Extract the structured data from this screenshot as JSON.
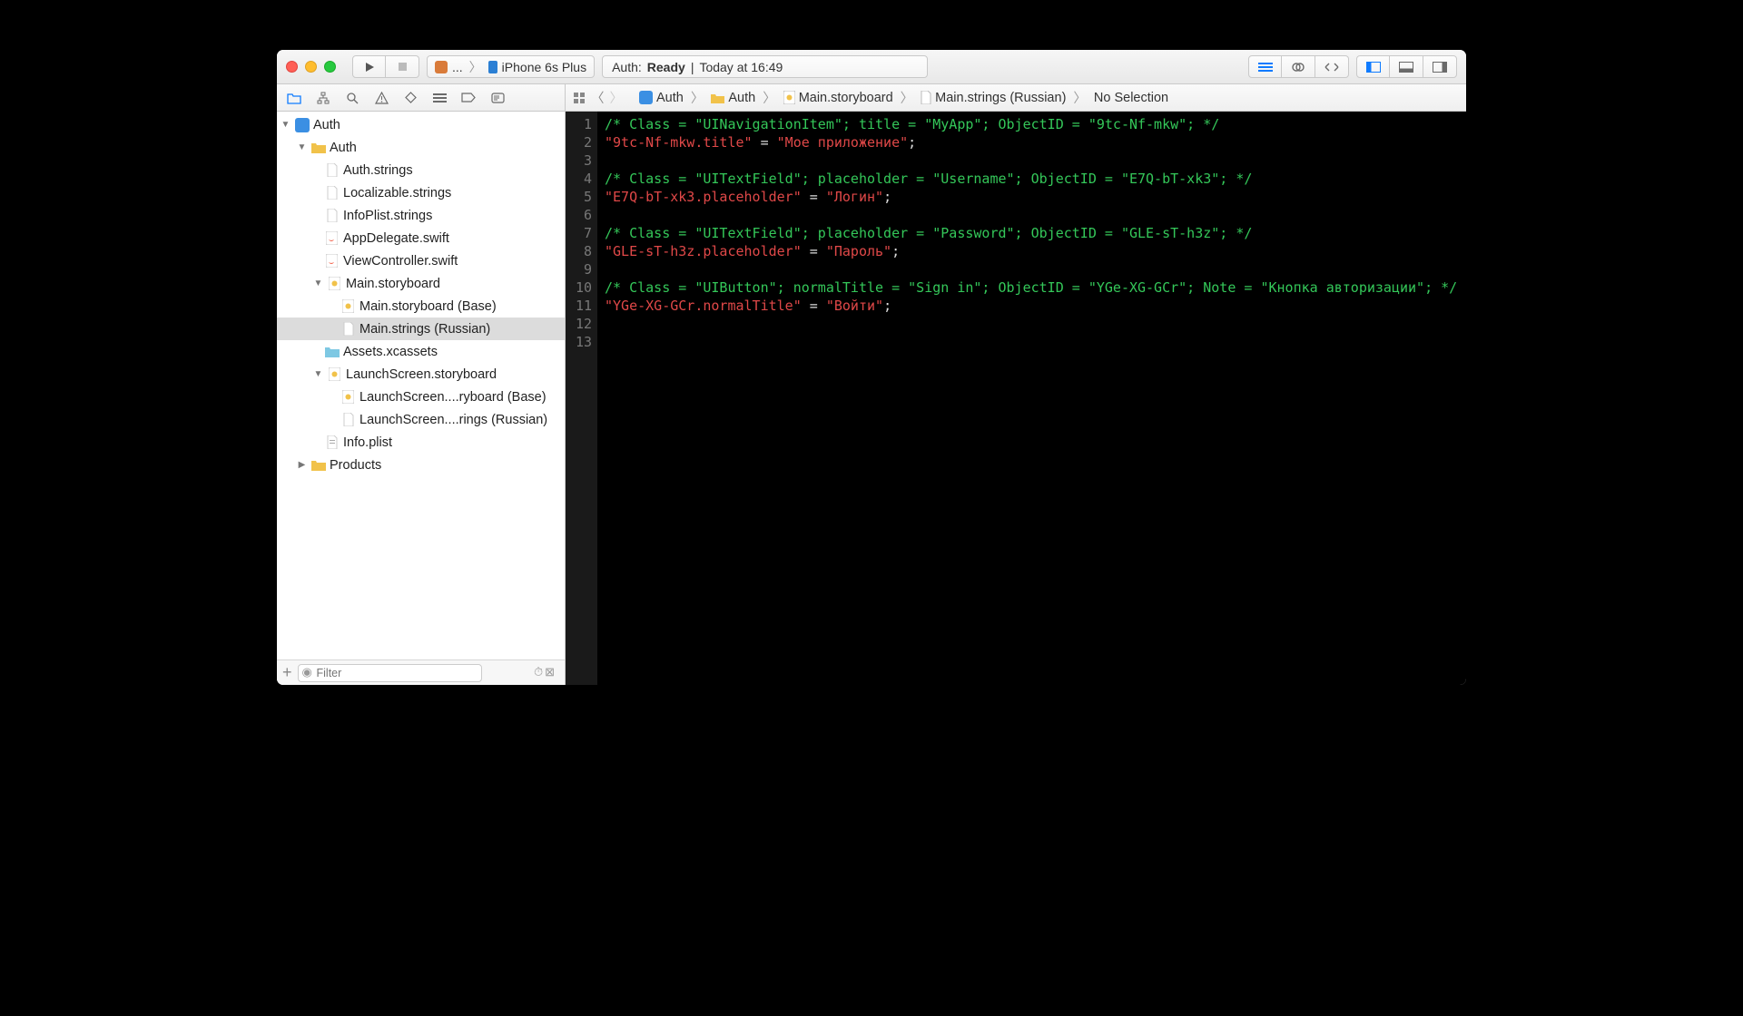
{
  "toolbar": {
    "scheme_app": "...",
    "scheme_device": "iPhone 6s Plus",
    "activity_prefix": "Auth: ",
    "activity_status": "Ready",
    "activity_sep": " | ",
    "activity_time": "Today at 16:49"
  },
  "breadcrumb": {
    "items": [
      "Auth",
      "Auth",
      "Main.storyboard",
      "Main.strings (Russian)",
      "No Selection"
    ]
  },
  "navigator": {
    "root": "Auth",
    "folder": "Auth",
    "files": {
      "f0": "Auth.strings",
      "f1": "Localizable.strings",
      "f2": "InfoPlist.strings",
      "f3": "AppDelegate.swift",
      "f4": "ViewController.swift",
      "f5": "Main.storyboard",
      "f5a": "Main.storyboard (Base)",
      "f5b": "Main.strings (Russian)",
      "f6": "Assets.xcassets",
      "f7": "LaunchScreen.storyboard",
      "f7a": "LaunchScreen....ryboard (Base)",
      "f7b": "LaunchScreen....rings (Russian)",
      "f8": "Info.plist",
      "products": "Products"
    },
    "filter_placeholder": "Filter"
  },
  "editor": {
    "line_count": 13,
    "code": {
      "l1": "/* Class = \"UINavigationItem\"; title = \"MyApp\"; ObjectID = \"9tc-Nf-mkw\"; */",
      "l2k": "\"9tc-Nf-mkw.title\"",
      "l2e": " = ",
      "l2v": "\"Мое приложение\"",
      "l4": "/* Class = \"UITextField\"; placeholder = \"Username\"; ObjectID = \"E7Q-bT-xk3\"; */",
      "l5k": "\"E7Q-bT-xk3.placeholder\"",
      "l5v": "\"Логин\"",
      "l7": "/* Class = \"UITextField\"; placeholder = \"Password\"; ObjectID = \"GLE-sT-h3z\"; */",
      "l8k": "\"GLE-sT-h3z.placeholder\"",
      "l8v": "\"Пароль\"",
      "l10": "/* Class = \"UIButton\"; normalTitle = \"Sign in\"; ObjectID = \"YGe-XG-GCr\"; Note = \"Кнопка авторизации\"; */",
      "l11k": "\"YGe-XG-GCr.normalTitle\"",
      "l11v": "\"Войти\"",
      "semi": ";"
    }
  }
}
